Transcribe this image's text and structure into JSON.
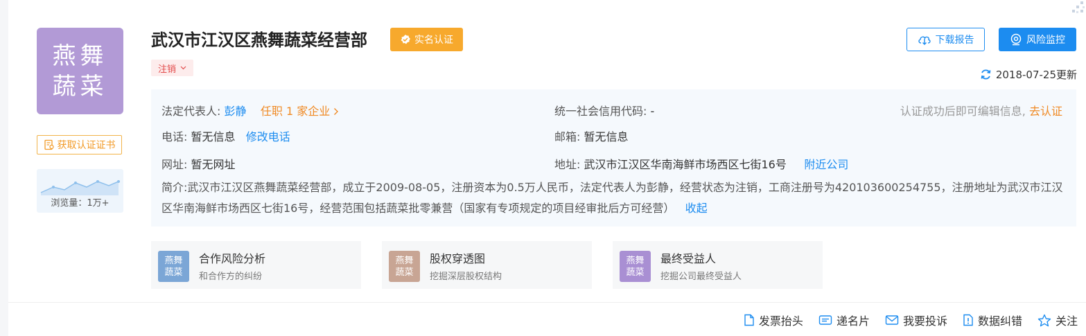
{
  "company": {
    "name": "武汉市江汉区燕舞蔬菜经营部",
    "logo_lines": [
      "燕舞",
      "蔬菜"
    ],
    "verified_badge": "实名认证",
    "status": "注销"
  },
  "left_panel": {
    "cert_button": "获取认证证书",
    "views_label": "浏览量：1万+"
  },
  "header_actions": {
    "download": "下载报告",
    "monitor": "风险监控",
    "updated": "2018-07-25更新"
  },
  "info": {
    "legal_rep_label": "法定代表人:",
    "legal_rep_value": "彭静",
    "positions_link": "任职 1 家企业",
    "credit_code_label": "统一社会信用代码:",
    "credit_code_value": "-",
    "verify_hint": "认证成功后即可编辑信息,",
    "verify_link": "去认证",
    "phone_label": "电话:",
    "phone_value": "暂无信息",
    "phone_edit": "修改电话",
    "email_label": "邮箱:",
    "email_value": "暂无信息",
    "website_label": "网址:",
    "website_value": "暂无网址",
    "address_label": "地址:",
    "address_value": "武汉市江汉区华南海鲜市场西区七街16号",
    "nearby_link": "附近公司",
    "intro_label": "简介:",
    "intro_text": "武汉市江汉区燕舞蔬菜经营部，成立于2009-08-05，注册资本为0.5万人民币，法定代表人为彭静，经营状态为注销，工商注册号为420103600254755，注册地址为武汉市江汉区华南海鲜市场西区七街16号，经营范围包括蔬菜批零兼营（国家有专项规定的项目经审批后方可经营）",
    "collapse_link": "收起"
  },
  "tiles": [
    {
      "title": "合作风险分析",
      "subtitle": "和合作方的纠纷",
      "icon_lines": [
        "燕舞",
        "蔬菜"
      ],
      "color": "#7ba6d6"
    },
    {
      "title": "股权穿透图",
      "subtitle": "挖掘深层股权结构",
      "icon_lines": [
        "燕舞",
        "蔬菜"
      ],
      "color": "#c8a594"
    },
    {
      "title": "最终受益人",
      "subtitle": "挖掘公司最终受益人",
      "icon_lines": [
        "燕舞",
        "蔬菜"
      ],
      "color": "#a98fd3"
    }
  ],
  "footer": {
    "invoice": "发票抬头",
    "card": "递名片",
    "complaint": "我要投诉",
    "correction": "数据纠错",
    "follow": "关注"
  },
  "colors": {
    "primary": "#1c8cf0",
    "orange": "#f08a24",
    "verified": "#f7a92d",
    "logo": "#b29ad6"
  }
}
